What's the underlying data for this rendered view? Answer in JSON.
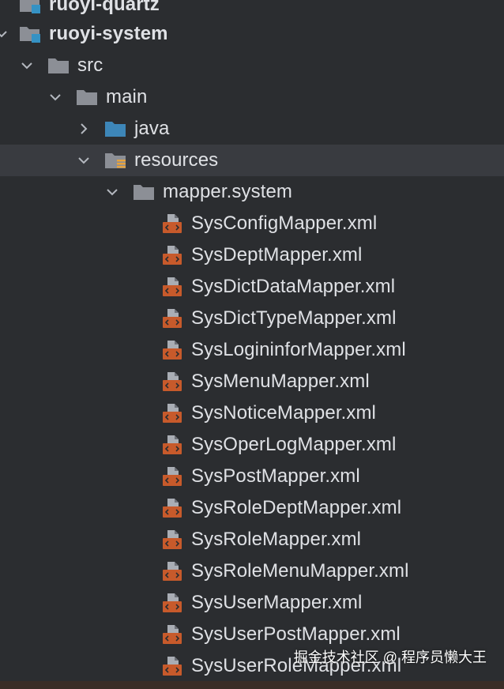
{
  "tree": {
    "modules": [
      {
        "label": "ruoyi-quartz",
        "expanded": false
      },
      {
        "label": "ruoyi-system",
        "expanded": true
      }
    ],
    "folders": {
      "src": "src",
      "main": "main",
      "java": "java",
      "resources": "resources",
      "mapper_system": "mapper.system"
    },
    "files": [
      "SysConfigMapper.xml",
      "SysDeptMapper.xml",
      "SysDictDataMapper.xml",
      "SysDictTypeMapper.xml",
      "SysLogininforMapper.xml",
      "SysMenuMapper.xml",
      "SysNoticeMapper.xml",
      "SysOperLogMapper.xml",
      "SysPostMapper.xml",
      "SysRoleDeptMapper.xml",
      "SysRoleMapper.xml",
      "SysRoleMenuMapper.xml",
      "SysUserMapper.xml",
      "SysUserPostMapper.xml",
      "SysUserRoleMapper.xml"
    ],
    "selected": "resources"
  },
  "watermark": "掘金技术社区 @ 程序员懒大王",
  "colors": {
    "background": "#2b2d30",
    "selection": "#393b40",
    "text": "#dfe1e5",
    "folder": "#8c8f96",
    "module_accent": "#3592c4",
    "source_folder": "#3d86b8",
    "resource_accent": "#e8a33d",
    "xml_icon": "#c75a2b"
  },
  "icons": {
    "module": "module-folder-icon",
    "folder": "folder-icon",
    "source_folder": "source-folder-icon",
    "resources_folder": "resources-folder-icon",
    "xml": "xml-file-icon",
    "expanded": "chevron-down-icon",
    "collapsed": "chevron-right-icon"
  }
}
